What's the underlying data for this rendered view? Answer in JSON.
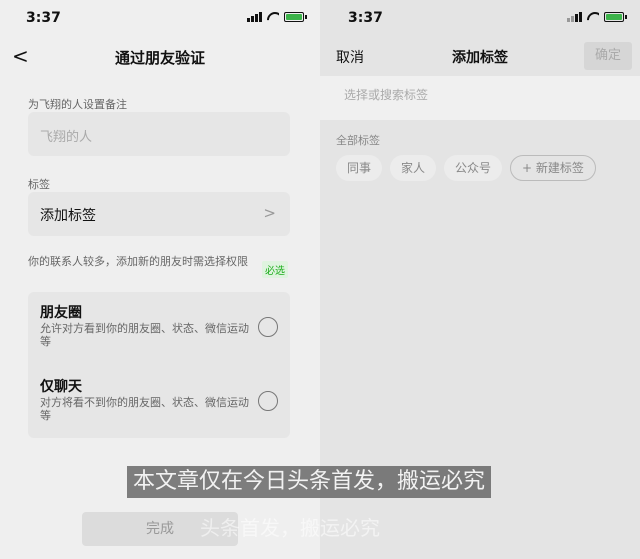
{
  "left": {
    "status": {
      "time": "3:37"
    },
    "nav": {
      "back": "<",
      "title": "通过朋友验证"
    },
    "remark": {
      "label": "为飞翔的人设置备注",
      "placeholder": "飞翔的人"
    },
    "tag": {
      "label": "标签",
      "value": "添加标签",
      "chevron": ">"
    },
    "permission": {
      "label": "你的联系人较多，添加新的朋友时需选择权限",
      "required": "必选",
      "options": [
        {
          "title": "朋友圈",
          "desc": "允许对方看到你的朋友圈、状态、微信运动等"
        },
        {
          "title": "仅聊天",
          "desc": "对方将看不到你的朋友圈、状态、微信运动等"
        }
      ]
    },
    "done": "完成"
  },
  "right": {
    "status": {
      "time": "3:37"
    },
    "nav": {
      "cancel": "取消",
      "title": "添加标签",
      "confirm": "确定"
    },
    "search": {
      "placeholder": "选择或搜索标签"
    },
    "all_label": "全部标签",
    "chips": [
      "同事",
      "家人",
      "公众号"
    ],
    "new_chip": "+ 新建标签"
  },
  "watermark": {
    "text": "本文章仅在今日头条首发，搬运必究",
    "faded": "头条首发，搬运必究"
  },
  "colors": {
    "accent": "#1aad19",
    "battery": "#3cb34a"
  },
  "icons": [
    "signal-icon",
    "wifi-icon",
    "battery-icon",
    "back-arrow-icon",
    "chevron-right-icon",
    "radio-circle-icon"
  ]
}
